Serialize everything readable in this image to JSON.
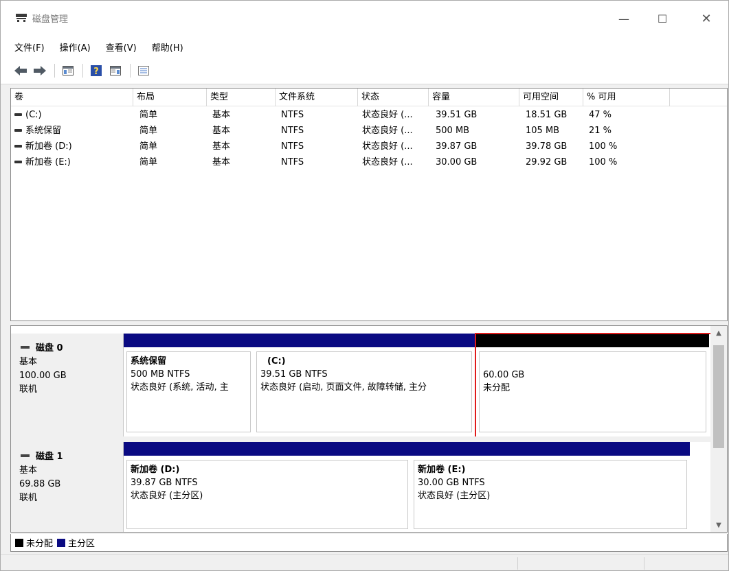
{
  "window": {
    "title": "磁盘管理",
    "controls": {
      "minimize": "—",
      "maximize": "☐",
      "close": "✕"
    }
  },
  "menubar": {
    "items": [
      "文件(F)",
      "操作(A)",
      "查看(V)",
      "帮助(H)"
    ]
  },
  "toolbar": {
    "buttons": [
      "back-arrow-icon",
      "forward-arrow-icon",
      "console-tree-icon",
      "help-icon",
      "action-pane-icon",
      "properties-icon"
    ]
  },
  "volume_list": {
    "columns": [
      "卷",
      "布局",
      "类型",
      "文件系统",
      "状态",
      "容量",
      "可用空间",
      "% 可用"
    ],
    "rows": [
      [
        "(C:)",
        "简单",
        "基本",
        "NTFS",
        "状态良好 (...",
        "39.51 GB",
        "18.51 GB",
        "47 %"
      ],
      [
        "系统保留",
        "简单",
        "基本",
        "NTFS",
        "状态良好 (...",
        "500 MB",
        "105 MB",
        "21 %"
      ],
      [
        "新加卷 (D:)",
        "简单",
        "基本",
        "NTFS",
        "状态良好 (...",
        "39.87 GB",
        "39.78 GB",
        "100 %"
      ],
      [
        "新加卷 (E:)",
        "简单",
        "基本",
        "NTFS",
        "状态良好 (...",
        "30.00 GB",
        "29.92 GB",
        "100 %"
      ]
    ]
  },
  "disks": [
    {
      "name": "磁盘 0",
      "type": "基本",
      "size": "100.00 GB",
      "status": "联机",
      "partitions": [
        {
          "name": "系统保留",
          "fs": "500 MB NTFS",
          "status": "状态良好 (系统, 活动, 主",
          "kind": "primary"
        },
        {
          "name": "(C:)",
          "fs": "39.51 GB NTFS",
          "status": "状态良好 (启动, 页面文件, 故障转储, 主分",
          "kind": "primary"
        },
        {
          "name": "",
          "fs": "60.00 GB",
          "status": "未分配",
          "kind": "unallocated"
        }
      ]
    },
    {
      "name": "磁盘 1",
      "type": "基本",
      "size": "69.88 GB",
      "status": "联机",
      "partitions": [
        {
          "name": "新加卷  (D:)",
          "fs": "39.87 GB NTFS",
          "status": "状态良好 (主分区)",
          "kind": "primary"
        },
        {
          "name": "新加卷  (E:)",
          "fs": "30.00 GB NTFS",
          "status": "状态良好 (主分区)",
          "kind": "primary"
        }
      ]
    }
  ],
  "legend": {
    "unallocated": "未分配",
    "primary": "主分区"
  },
  "colors": {
    "primary_bar": "#0a0a82",
    "unallocated_bar": "#000000",
    "selection_outline": "#e01b1b"
  }
}
